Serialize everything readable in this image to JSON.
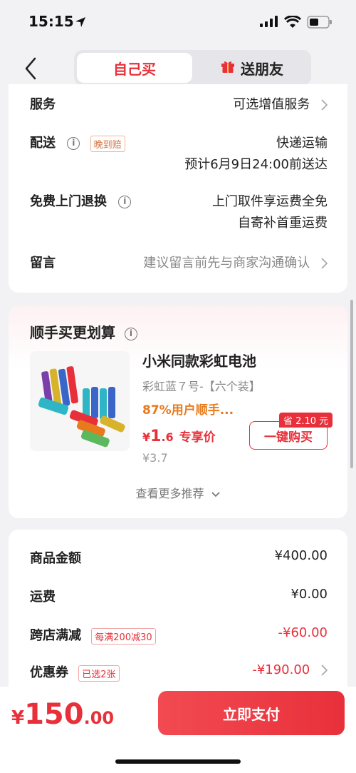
{
  "status": {
    "time": "15:15"
  },
  "nav": {
    "tab_self": "自己买",
    "tab_gift": "送朋友"
  },
  "order": {
    "service_label": "服务",
    "service_value": "可选增值服务",
    "delivery_label": "配送",
    "delivery_tag": "晚到赔",
    "delivery_method": "快递运输",
    "delivery_eta": "预计6月9日24:00前送达",
    "return_label": "免费上门退换",
    "return_line1": "上门取件享运费全免",
    "return_line2": "自寄补首重运费",
    "message_label": "留言",
    "message_placeholder": "建议留言前先与商家沟通确认"
  },
  "addon": {
    "title": "顺手买更划算",
    "product_name": "小米同款彩虹电池",
    "spec": "彩虹蓝７号-【六个装】",
    "stat": "87%用户顺手...",
    "price_symbol": "¥",
    "price_int": "1",
    "price_dec": ".6",
    "price_label": "专享价",
    "orig_price": "¥3.7",
    "save_badge": "省 2.10 元",
    "buy_button": "一键购买",
    "more": "查看更多推荐"
  },
  "summary": {
    "goods_label": "商品金额",
    "goods_value": "¥400.00",
    "shipping_label": "运费",
    "shipping_value": "¥0.00",
    "cross_label": "跨店满减",
    "cross_tag": "每满200减30",
    "cross_value": "-¥60.00",
    "coupon_label": "优惠券",
    "coupon_tag": "已选2张",
    "coupon_value": "-¥190.00"
  },
  "footer": {
    "total_symbol": "¥",
    "total_int": "150",
    "total_dec": ".00",
    "pay_button": "立即支付"
  },
  "colors": {
    "accent": "#e8303a",
    "orange": "#e87a1d",
    "background": "#f2f2f4"
  }
}
